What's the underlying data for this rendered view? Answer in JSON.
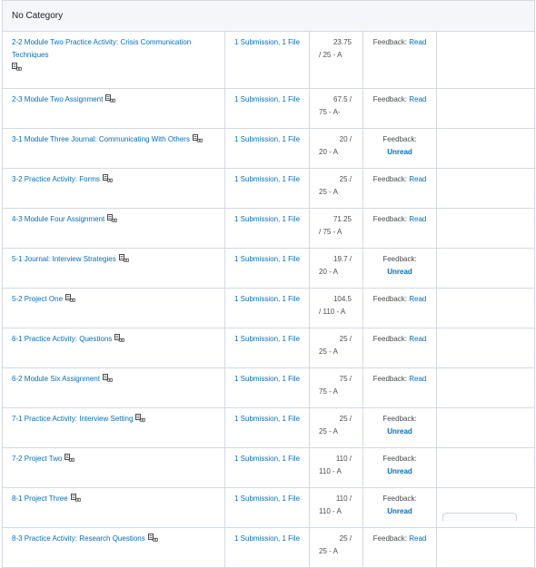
{
  "category": {
    "title": "No Category"
  },
  "rows": [
    {
      "name": "2-2 Module Two Practice Activity: Crisis Communication Techniques",
      "submission": "1 Submission, 1 File",
      "grade_line1": "23.75",
      "grade_line2": "/ 25 - A",
      "feedback_label": "Feedback:",
      "feedback_status": "Read",
      "status_type": "read",
      "tall": true
    },
    {
      "name": "2-3 Module Two Assignment",
      "submission": "1 Submission, 1 File",
      "grade_line1": "67.5 /",
      "grade_line2": "75 - A-",
      "feedback_label": "Feedback:",
      "feedback_status": "Read",
      "status_type": "read"
    },
    {
      "name": "3-1 Module Three Journal: Communicating With Others",
      "submission": "1 Submission, 1 File",
      "grade_line1": "20 /",
      "grade_line2": "20 - A",
      "feedback_label": "Feedback:",
      "feedback_status": "Unread",
      "status_type": "unread"
    },
    {
      "name": "3-2 Practice Activity: Forms",
      "submission": "1 Submission, 1 File",
      "grade_line1": "25 /",
      "grade_line2": "25 - A",
      "feedback_label": "Feedback:",
      "feedback_status": "Read",
      "status_type": "read"
    },
    {
      "name": "4-3 Module Four Assignment",
      "submission": "1 Submission, 1 File",
      "grade_line1": "71.25",
      "grade_line2": "/ 75 - A",
      "feedback_label": "Feedback:",
      "feedback_status": "Read",
      "status_type": "read"
    },
    {
      "name": "5-1 Journal: Interview Strategies",
      "submission": "1 Submission, 1 File",
      "grade_line1": "19.7 /",
      "grade_line2": "20 - A",
      "feedback_label": "Feedback:",
      "feedback_status": "Unread",
      "status_type": "unread"
    },
    {
      "name": "5-2 Project One",
      "submission": "1 Submission, 1 File",
      "grade_line1": "104.5",
      "grade_line2": "/ 110 - A",
      "feedback_label": "Feedback:",
      "feedback_status": "Read",
      "status_type": "read"
    },
    {
      "name": "6-1 Practice Activity: Questions",
      "submission": "1 Submission, 1 File",
      "grade_line1": "25 /",
      "grade_line2": "25 - A",
      "feedback_label": "Feedback:",
      "feedback_status": "Read",
      "status_type": "read"
    },
    {
      "name": "6-2 Module Six Assignment",
      "submission": "1 Submission, 1 File",
      "grade_line1": "75 /",
      "grade_line2": "75 - A",
      "feedback_label": "Feedback:",
      "feedback_status": "Read",
      "status_type": "read"
    },
    {
      "name": "7-1 Practice Activity: Interview Setting",
      "submission": "1 Submission, 1 File",
      "grade_line1": "25 /",
      "grade_line2": "25 - A",
      "feedback_label": "Feedback:",
      "feedback_status": "Unread",
      "status_type": "unread"
    },
    {
      "name": "7-2 Project Two",
      "submission": "1 Submission, 1 File",
      "grade_line1": "110 /",
      "grade_line2": "110 - A",
      "feedback_label": "Feedback:",
      "feedback_status": "Unread",
      "status_type": "unread"
    },
    {
      "name": "8-1 Project Three",
      "submission": "1 Submission, 1 File",
      "grade_line1": "110 /",
      "grade_line2": "110 - A",
      "feedback_label": "Feedback:",
      "feedback_status": "Unread",
      "status_type": "unread"
    },
    {
      "name": "8-3 Practice Activity: Research Questions",
      "submission": "1 Submission, 1 File",
      "grade_line1": "25 /",
      "grade_line2": "25 - A",
      "feedback_label": "Feedback:",
      "feedback_status": "Read",
      "status_type": "read"
    }
  ],
  "icons": {
    "rubric": "rubric-icon"
  },
  "colors": {
    "link": "#006fbf",
    "border": "#d3d9e3",
    "category_bg": "#f4f6f9"
  }
}
